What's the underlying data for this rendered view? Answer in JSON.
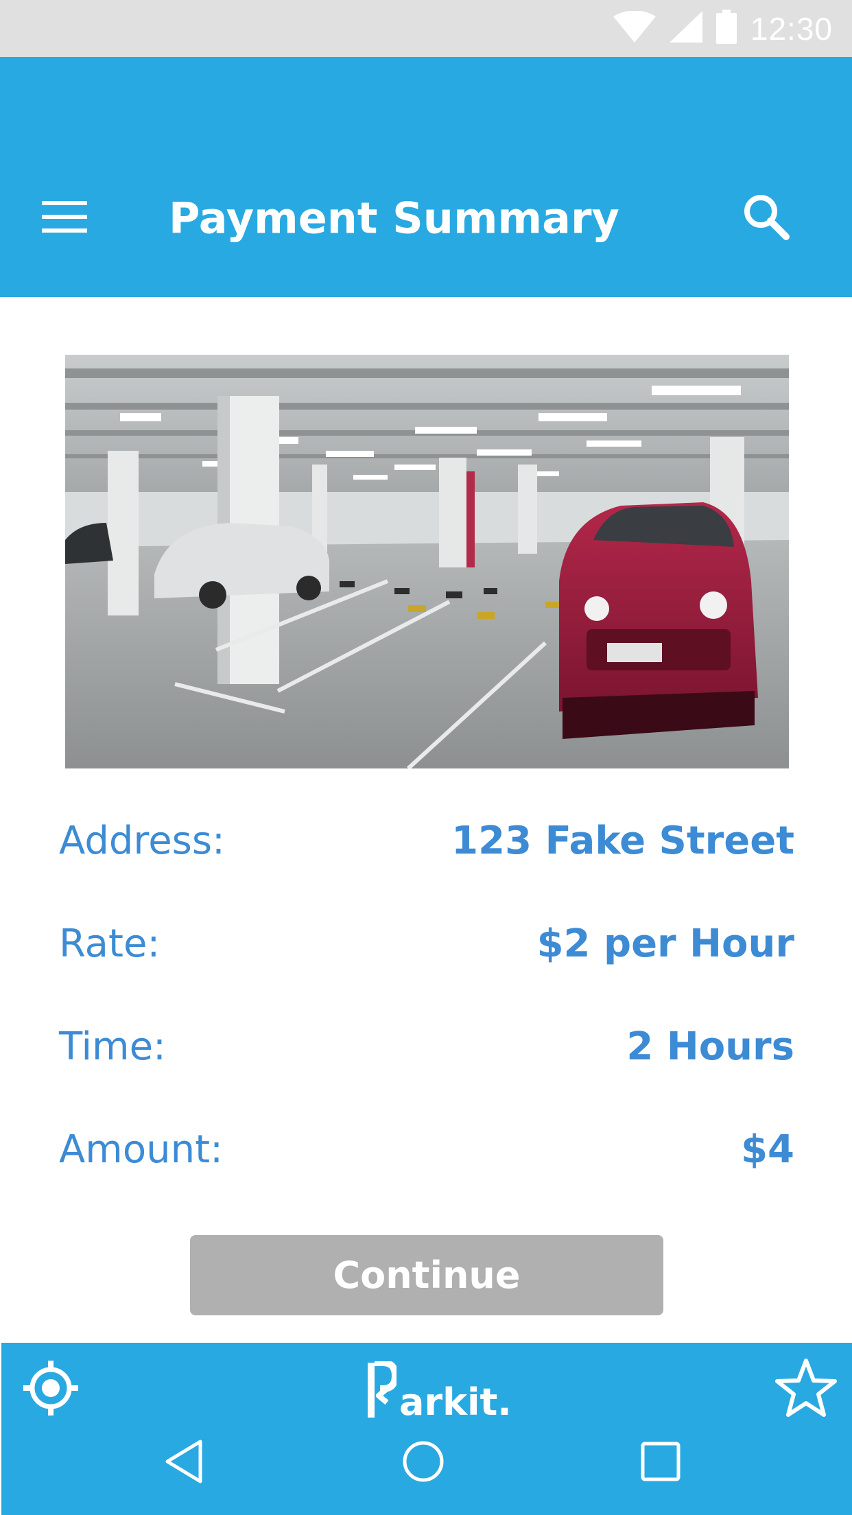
{
  "status_bar": {
    "time": "12:30",
    "icons": [
      "wifi-icon",
      "cellular-signal-icon",
      "battery-icon"
    ]
  },
  "app_bar": {
    "title": "Payment Summary",
    "menu_icon": "hamburger-menu-icon",
    "search_icon": "search-icon"
  },
  "photo": {
    "subject": "parking-garage-photo"
  },
  "details": {
    "address": {
      "label": "Address:",
      "value": "123 Fake Street"
    },
    "rate": {
      "label": "Rate:",
      "value": "$2 per Hour"
    },
    "time": {
      "label": "Time:",
      "value": "2 Hours"
    },
    "amount": {
      "label": "Amount:",
      "value": "$4"
    }
  },
  "continue_button": {
    "label": "Continue"
  },
  "bottom_bar": {
    "brand_text": "arkit.",
    "brand_full": "Parkit.",
    "location_icon": "locate-crosshair-icon",
    "favorite_icon": "star-outline-icon"
  },
  "nav": {
    "back_icon": "nav-back-icon",
    "home_icon": "nav-home-icon",
    "recents_icon": "nav-recents-icon"
  },
  "colors": {
    "primary": "#29a9e1",
    "text_blue": "#3d8bd4",
    "button_disabled": "#b0b0b0",
    "status_bar": "#e0e0e0"
  }
}
